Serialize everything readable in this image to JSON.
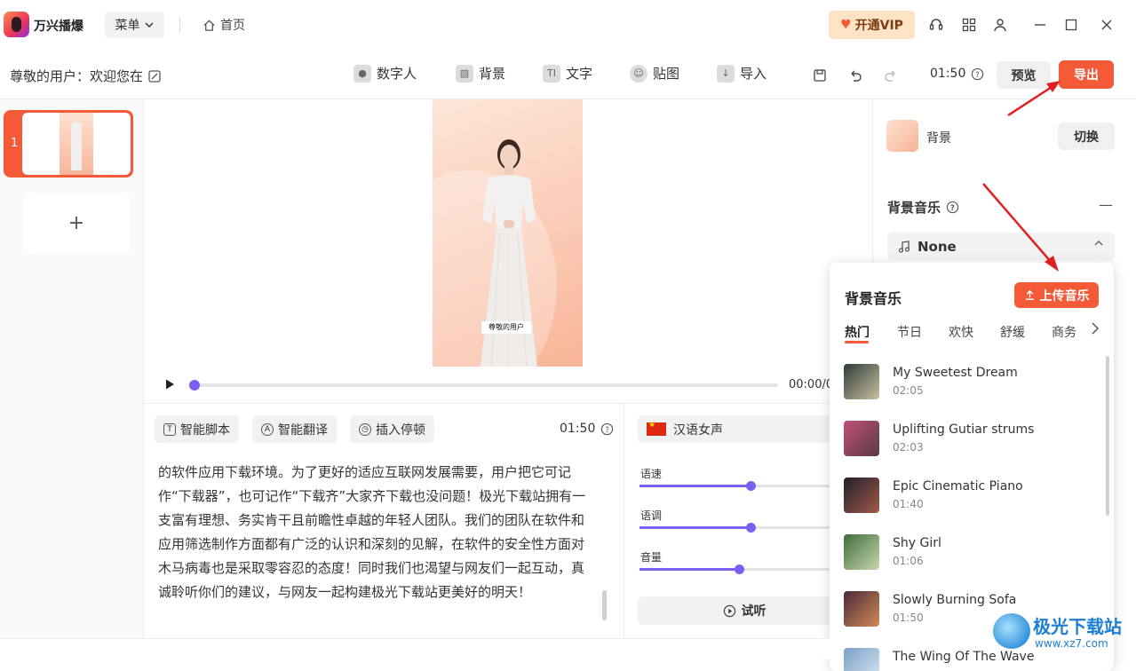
{
  "app": {
    "name": "万兴播爆",
    "menu_label": "菜单",
    "home_label": "首页",
    "vip_label": "开通VIP"
  },
  "toolbar": {
    "greeting": "尊敬的用户：欢迎您在",
    "tools": [
      "数字人",
      "背景",
      "文字",
      "贴图",
      "导入"
    ],
    "duration": "01:50",
    "preview_label": "预览",
    "export_label": "导出"
  },
  "scenes": {
    "items": [
      {
        "number": "1"
      }
    ],
    "add_label": "+"
  },
  "stage": {
    "subtitle": "尊敬的用户",
    "time_readout": "00:00/0",
    "progress": 0
  },
  "script": {
    "buttons": [
      "智能脚本",
      "智能翻译",
      "插入停顿"
    ],
    "duration": "01:50",
    "text": "的软件应用下载环境。为了更好的适应互联网发展需要，用户把它可记作“下载器”，也可记作“下载齐”大家齐下载也没问题！极光下载站拥有一支富有理想、务实肯干且前瞻性卓越的年轻人团队。我们的团队在软件和应用筛选制作方面都有广泛的认识和深刻的见解，在软件的安全性方面对木马病毒也是采取零容忍的态度！同时我们也渴望与网友们一起互动，真诚聆听你们的建议，与网友一起构建极光下载站更美好的明天！"
  },
  "voice": {
    "selected": "汉语女声",
    "sliders": [
      {
        "label": "语速",
        "value": 0.48
      },
      {
        "label": "语调",
        "value": 0.48
      },
      {
        "label": "音量",
        "value": 0.43
      }
    ],
    "listen_label": "试听"
  },
  "right_panel": {
    "background_label": "背景",
    "switch_label": "切换",
    "bgm_title": "背景音乐",
    "bgm_collapse": "—",
    "bgm_selected": "None"
  },
  "music_popup": {
    "title": "背景音乐",
    "upload_label": "上传音乐",
    "categories": [
      "热门",
      "节日",
      "欢快",
      "舒缓",
      "商务"
    ],
    "active_category": "热门",
    "tracks": [
      {
        "name": "My Sweetest Dream",
        "duration": "02:05",
        "colors": [
          "#2f3b38",
          "#c9c1a0"
        ]
      },
      {
        "name": "Uplifting Gutiar strums",
        "duration": "02:03",
        "colors": [
          "#c0507a",
          "#5a3b40"
        ]
      },
      {
        "name": "Epic Cinematic Piano",
        "duration": "01:40",
        "colors": [
          "#1f1f28",
          "#a35a4a"
        ]
      },
      {
        "name": "Shy Girl",
        "duration": "01:06",
        "colors": [
          "#3f6e3a",
          "#c9d6b0"
        ]
      },
      {
        "name": "Slowly Burning Sofa",
        "duration": "01:50",
        "colors": [
          "#4a2a3a",
          "#d28a55"
        ]
      },
      {
        "name": "The Wing Of The Wave",
        "duration": "",
        "colors": [
          "#7aa0c8",
          "#dce8f2"
        ]
      }
    ]
  },
  "watermark": {
    "text": "极光下载站",
    "url": "www.xz7.com"
  },
  "colors": {
    "accent": "#f45a38",
    "slider": "#7b5ff2",
    "arrow": "#e02020"
  }
}
